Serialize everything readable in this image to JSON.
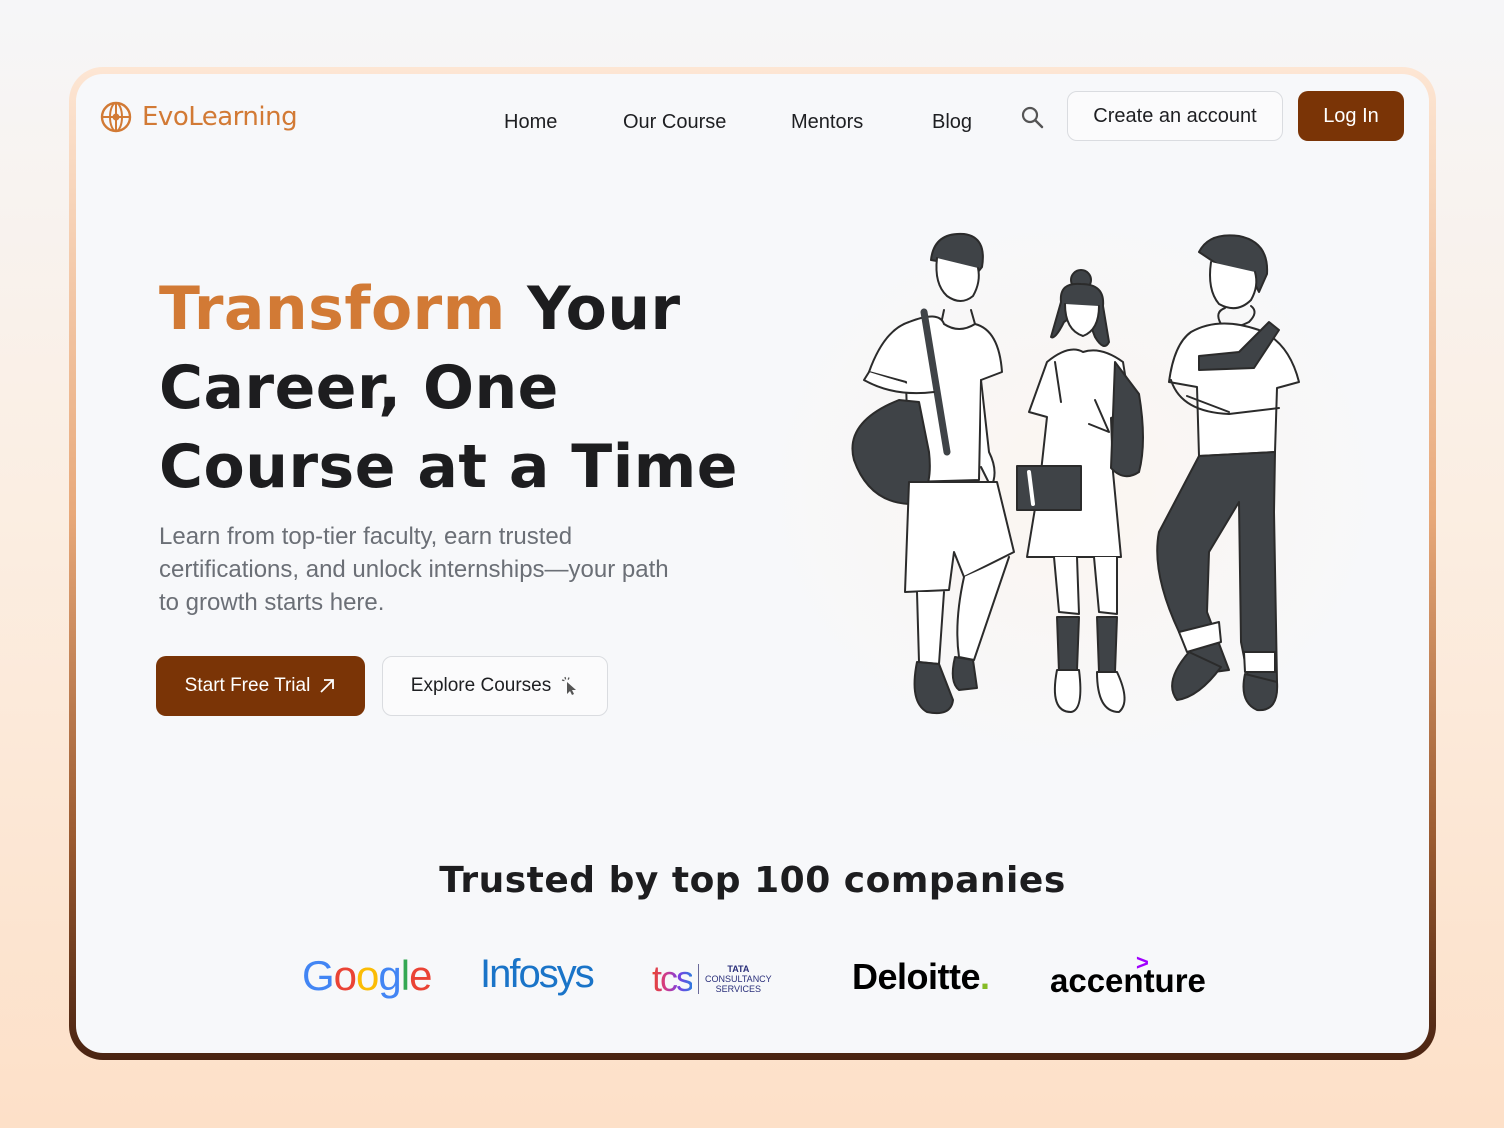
{
  "brand": {
    "name": "EvoLearning",
    "accent_color": "#d27a35",
    "primary_color": "#7a3406"
  },
  "nav": {
    "links": [
      "Home",
      "Our Course",
      "Mentors",
      "Blog"
    ],
    "search_icon": "search-icon",
    "create_account_label": "Create an account",
    "login_label": "Log In"
  },
  "hero": {
    "title_accent": "Transform",
    "title_rest_1": " Your",
    "title_line_2": "Career, One",
    "title_line_3": "Course at a Time",
    "description": "Learn from top-tier faculty, earn trusted certifications, and unlock internships—your path to growth starts here.",
    "primary_cta": "Start Free Trial",
    "primary_cta_icon": "arrow-up-right-icon",
    "secondary_cta": "Explore Courses",
    "secondary_cta_icon": "cursor-click-icon"
  },
  "trust": {
    "title": "Trusted by top 100 companies",
    "companies": {
      "google": "Google",
      "infosys": "Infosys",
      "tcs": "tcs",
      "tcs_sub_1": "TATA",
      "tcs_sub_2": "CONSULTANCY",
      "tcs_sub_3": "SERVICES",
      "deloitte": "Deloitte",
      "deloitte_dot": ".",
      "accenture": "accenture"
    }
  }
}
